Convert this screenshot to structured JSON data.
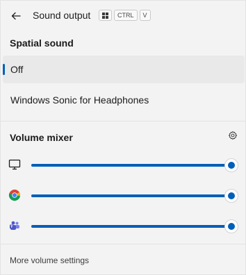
{
  "header": {
    "title": "Sound output",
    "shortcut_keys": [
      "CTRL",
      "V"
    ],
    "back_icon": "back-arrow-icon",
    "win_key_icon": "windows-logo-icon"
  },
  "spatial": {
    "title": "Spatial sound",
    "options": [
      {
        "label": "Off",
        "selected": true
      },
      {
        "label": "Windows Sonic for Headphones",
        "selected": false
      }
    ]
  },
  "mixer": {
    "title": "Volume mixer",
    "settings_icon": "gear-icon",
    "rows": [
      {
        "icon": "monitor-icon",
        "level": 1.0
      },
      {
        "icon": "chrome-icon",
        "level": 1.0
      },
      {
        "icon": "teams-icon",
        "level": 1.0
      }
    ]
  },
  "footer": {
    "link": "More volume settings"
  },
  "colors": {
    "accent": "#005fb8",
    "background": "#f3f3f3",
    "selected_bg": "#e9e9e9"
  }
}
